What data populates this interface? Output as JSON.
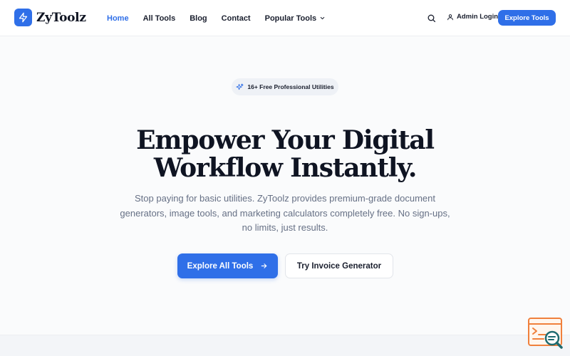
{
  "brand": {
    "name": "ZyToolz",
    "logo_icon": "lightning-bolt-icon"
  },
  "nav": {
    "links": [
      {
        "label": "Home",
        "active": true
      },
      {
        "label": "All Tools",
        "active": false
      },
      {
        "label": "Blog",
        "active": false
      },
      {
        "label": "Contact",
        "active": false
      }
    ],
    "dropdown": {
      "label": "Popular Tools",
      "icon": "chevron-down-icon"
    },
    "search_icon": "search-icon",
    "admin_login": {
      "label": "Admin Login",
      "icon": "user-icon"
    },
    "cta_label": "Explore Tools"
  },
  "hero": {
    "badge": {
      "label": "16+ Free Professional Utilities",
      "icon": "sparkles-icon"
    },
    "title_line1": "Empower Your Digital",
    "title_line2": "Workflow Instantly.",
    "subtitle": "Stop paying for basic utilities. ZyToolz provides premium-grade document generators, image tools, and marketing calculators completely free. No sign-ups, no limits, just results.",
    "primary_button": {
      "label": "Explore All Tools",
      "icon": "arrow-right-icon"
    },
    "secondary_button": {
      "label": "Try Invoice Generator"
    }
  },
  "widget": {
    "icon": "code-search-icon"
  },
  "colors": {
    "accent": "#2f6fe8",
    "text": "#0f1422",
    "muted": "#667085",
    "widget_orange": "#f0803c",
    "widget_teal": "#1e6b70"
  }
}
